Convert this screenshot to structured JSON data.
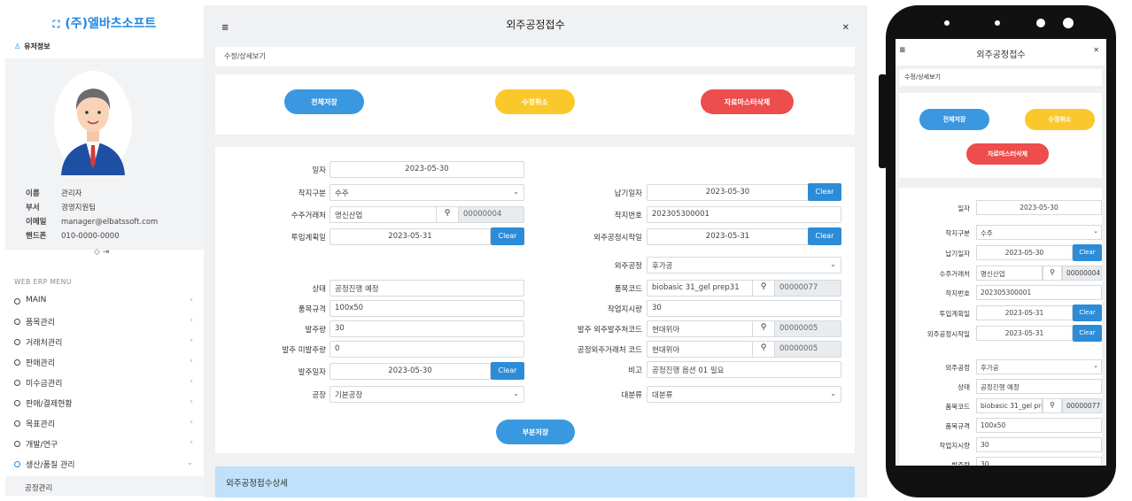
{
  "sidebar": {
    "company": "(주)엘바츠소프트",
    "user_header": "유저정보",
    "user": {
      "name_k": "이름",
      "name_v": "관리자",
      "dept_k": "부서",
      "dept_v": "경영지원팀",
      "email_k": "이메일",
      "email_v": "manager@elbatssoft.com",
      "phone_k": "핸드폰",
      "phone_v": "010-0000-0000"
    },
    "menu_header": "WEB ERP MENU",
    "menu": [
      {
        "label": "MAIN"
      },
      {
        "label": "품목관리"
      },
      {
        "label": "거래처관리"
      },
      {
        "label": "판매관리"
      },
      {
        "label": "미수금관리"
      },
      {
        "label": "판매/결제현황"
      },
      {
        "label": "목표관리"
      },
      {
        "label": "개발/연구"
      },
      {
        "label": "생산/품질 관리"
      }
    ],
    "submenu": "공정관리"
  },
  "main": {
    "title": "외주공정접수",
    "breadcrumb": "수정/상세보기",
    "buttons": {
      "save_all": "전체저장",
      "cancel_edit": "수정취소",
      "delete_master": "자료마스터삭제",
      "partial_save": "부분저장"
    },
    "clear_label": "Clear",
    "form": {
      "date_label": "일자",
      "date": "2023-05-30",
      "order_type_label": "작지구분",
      "order_type": "수주",
      "customer_label": "수주거래처",
      "customer": "명신산업",
      "customer_code": "00000004",
      "input_plan_label": "투입계획일",
      "input_plan": "2023-05-31",
      "delivery_label": "납기일자",
      "delivery": "2023-05-30",
      "work_no_label": "작지번호",
      "work_no": "202305300001",
      "process_start_label": "외주공정시작일",
      "process_start": "2023-05-31",
      "process_label": "외주공정",
      "process": "후가공",
      "status_label": "상태",
      "status": "공정진행 예정",
      "item_code_label": "품목코드",
      "item_code": "biobasic 31_gel prep31",
      "item_code_no": "00000077",
      "spec_label": "품목규격",
      "spec": "100x50",
      "work_qty_label": "작업지시량",
      "work_qty": "30",
      "order_qty_label": "발주량",
      "order_qty": "30",
      "vendor_label": "발주 외주발주처코드",
      "vendor": "현대위아",
      "vendor_code": "00000005",
      "unorder_label": "발주 미발주량",
      "unorder": "0",
      "process_vendor_label": "공정외주거래처 코드",
      "process_vendor": "현대위아",
      "process_vendor_code": "00000005",
      "order_date_label": "발주일자",
      "order_date": "2023-05-30",
      "remark_label": "비고",
      "remark": "공정진행 옵션 01 필요",
      "factory_label": "공장",
      "factory": "기본공장",
      "category_label": "대분류",
      "category": "대분류"
    },
    "detail_header": "외주공정접수상세"
  },
  "mobile": {
    "item_code": "biobasic 31_gel pre"
  }
}
